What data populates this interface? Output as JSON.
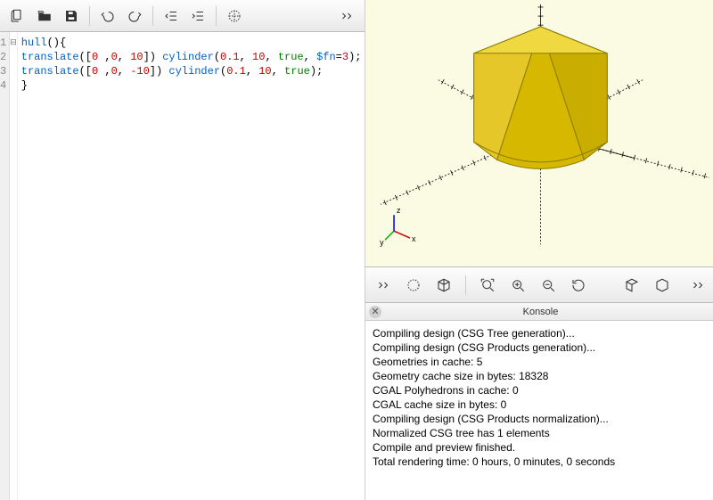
{
  "editor": {
    "lines": [
      "1",
      "2",
      "3",
      "4"
    ],
    "fold": [
      "⊟",
      "",
      "",
      ""
    ],
    "code": [
      {
        "tokens": [
          {
            "t": "hull",
            "c": "kw"
          },
          {
            "t": "(){",
            "c": "punc"
          }
        ]
      },
      {
        "tokens": [
          {
            "t": "translate",
            "c": "kw"
          },
          {
            "t": "([",
            "c": "punc"
          },
          {
            "t": "0",
            "c": "num"
          },
          {
            "t": " ,",
            "c": "punc"
          },
          {
            "t": "0",
            "c": "num"
          },
          {
            "t": ", ",
            "c": "punc"
          },
          {
            "t": "10",
            "c": "num"
          },
          {
            "t": "]) ",
            "c": "punc"
          },
          {
            "t": "cylinder",
            "c": "kw"
          },
          {
            "t": "(",
            "c": "punc"
          },
          {
            "t": "0.1",
            "c": "num"
          },
          {
            "t": ", ",
            "c": "punc"
          },
          {
            "t": "10",
            "c": "num"
          },
          {
            "t": ", ",
            "c": "punc"
          },
          {
            "t": "true",
            "c": "bool"
          },
          {
            "t": ", ",
            "c": "punc"
          },
          {
            "t": "$fn",
            "c": "var"
          },
          {
            "t": "=",
            "c": "punc"
          },
          {
            "t": "3",
            "c": "num"
          },
          {
            "t": ");",
            "c": "punc"
          }
        ]
      },
      {
        "tokens": [
          {
            "t": "translate",
            "c": "kw"
          },
          {
            "t": "([",
            "c": "punc"
          },
          {
            "t": "0",
            "c": "num"
          },
          {
            "t": " ,",
            "c": "punc"
          },
          {
            "t": "0",
            "c": "num"
          },
          {
            "t": ", ",
            "c": "punc"
          },
          {
            "t": "-10",
            "c": "num"
          },
          {
            "t": "]) ",
            "c": "punc"
          },
          {
            "t": "cylinder",
            "c": "kw"
          },
          {
            "t": "(",
            "c": "punc"
          },
          {
            "t": "0.1",
            "c": "num"
          },
          {
            "t": ", ",
            "c": "punc"
          },
          {
            "t": "10",
            "c": "num"
          },
          {
            "t": ", ",
            "c": "punc"
          },
          {
            "t": "true",
            "c": "bool"
          },
          {
            "t": ");",
            "c": "punc"
          }
        ]
      },
      {
        "tokens": [
          {
            "t": "}",
            "c": "punc"
          }
        ]
      }
    ]
  },
  "console": {
    "title": "Konsole",
    "lines": [
      "Compiling design (CSG Tree generation)...",
      "Compiling design (CSG Products generation)...",
      "Geometries in cache: 5",
      "Geometry cache size in bytes: 18328",
      "CGAL Polyhedrons in cache: 0",
      "CGAL cache size in bytes: 0",
      "Compiling design (CSG Products normalization)...",
      "Normalized CSG tree has 1 elements",
      "Compile and preview finished.",
      "Total rendering time: 0 hours, 0 minutes, 0 seconds"
    ]
  },
  "axis": {
    "x": "x",
    "y": "y",
    "z": "z"
  }
}
